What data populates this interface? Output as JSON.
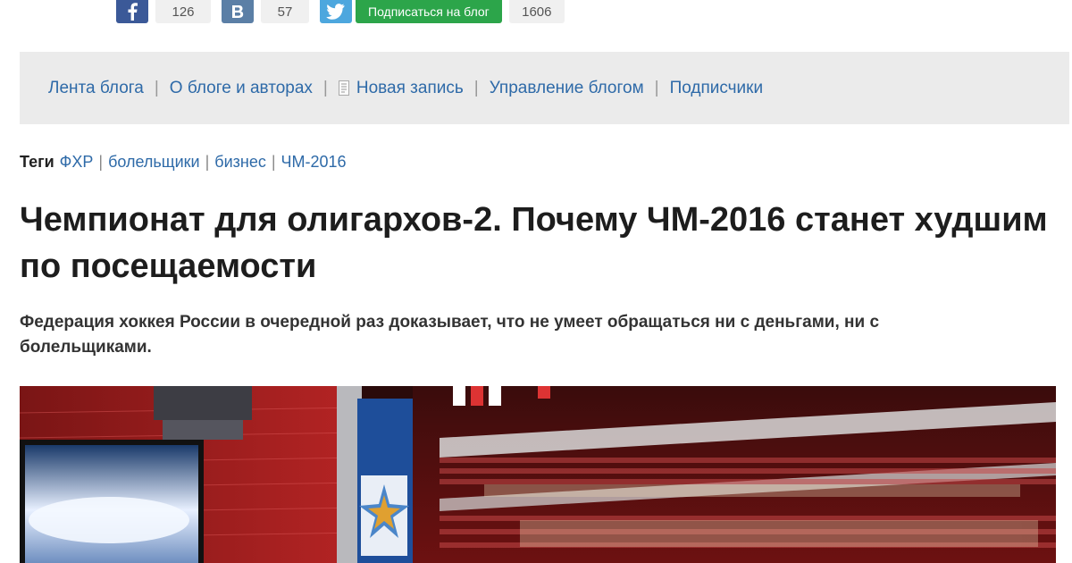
{
  "share": {
    "facebook_count": "126",
    "vk_count": "57",
    "subscribe_label": "Подписаться на блог",
    "subscribers_count": "1606"
  },
  "nav": {
    "items": [
      {
        "label": "Лента блога"
      },
      {
        "label": "О блоге и авторах"
      },
      {
        "label": "Новая запись"
      },
      {
        "label": "Управление блогом"
      },
      {
        "label": "Подписчики"
      }
    ]
  },
  "tags": {
    "label": "Теги",
    "items": [
      "ФХР",
      "болельщики",
      "бизнес",
      "ЧМ-2016"
    ]
  },
  "article": {
    "headline": "Чемпионат для олигархов-2. Почему ЧМ-2016 станет худшим по посещаемости",
    "lede": "Федерация хоккея России в очередной раз доказывает, что не умеет обращаться ни с деньгами, ни с болельщиками."
  },
  "colors": {
    "link": "#2e6aa8",
    "subscribe": "#2ca54a",
    "facebook": "#3b5998",
    "vk": "#5b7fa6",
    "twitter": "#4da7de"
  }
}
